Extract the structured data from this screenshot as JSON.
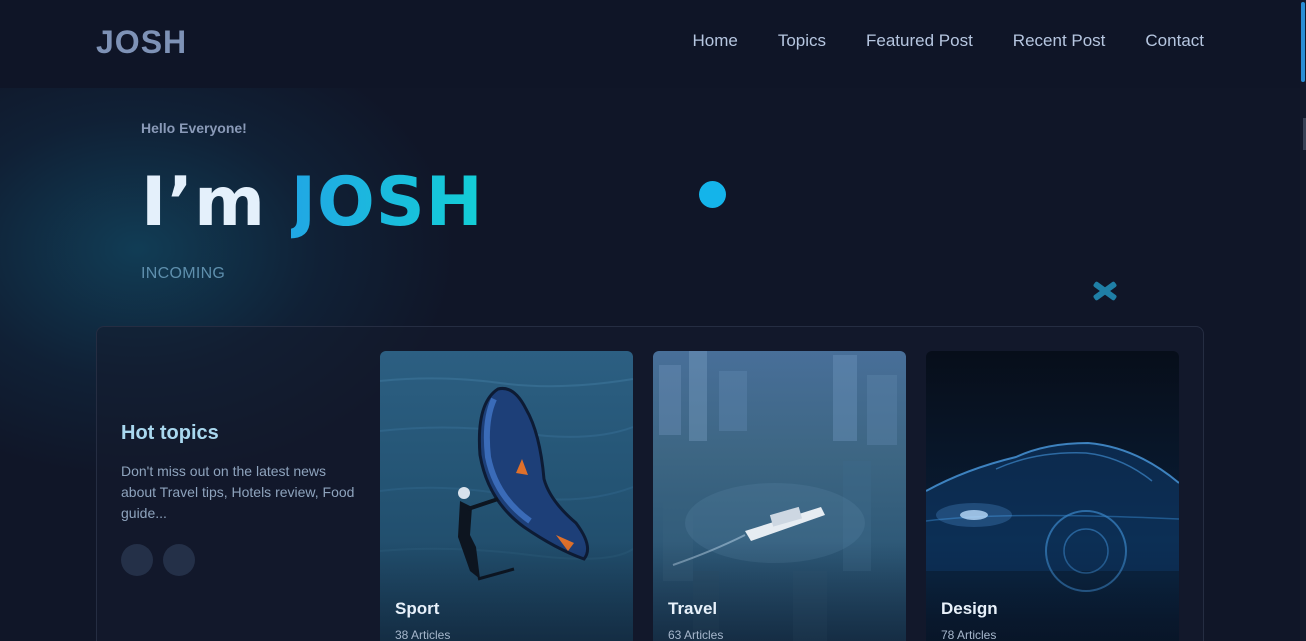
{
  "header": {
    "logo": "JOSH",
    "nav": [
      "Home",
      "Topics",
      "Featured Post",
      "Recent Post",
      "Contact"
    ]
  },
  "hero": {
    "greeting": "Hello Everyone!",
    "title_prefix": "I’m",
    "title_name": "JOSH",
    "tagline": "INCOMING"
  },
  "topics": {
    "title": "Hot topics",
    "description": "Don't miss out on the latest news about Travel tips, Hotels review, Food guide...",
    "cards": [
      {
        "name": "Sport",
        "count": "38 Articles"
      },
      {
        "name": "Travel",
        "count": "63 Articles"
      },
      {
        "name": "Design",
        "count": "78 Articles"
      }
    ]
  },
  "colors": {
    "background": "#101628",
    "accent": "#14b4ea",
    "accent_alt": "#13cfd6"
  }
}
